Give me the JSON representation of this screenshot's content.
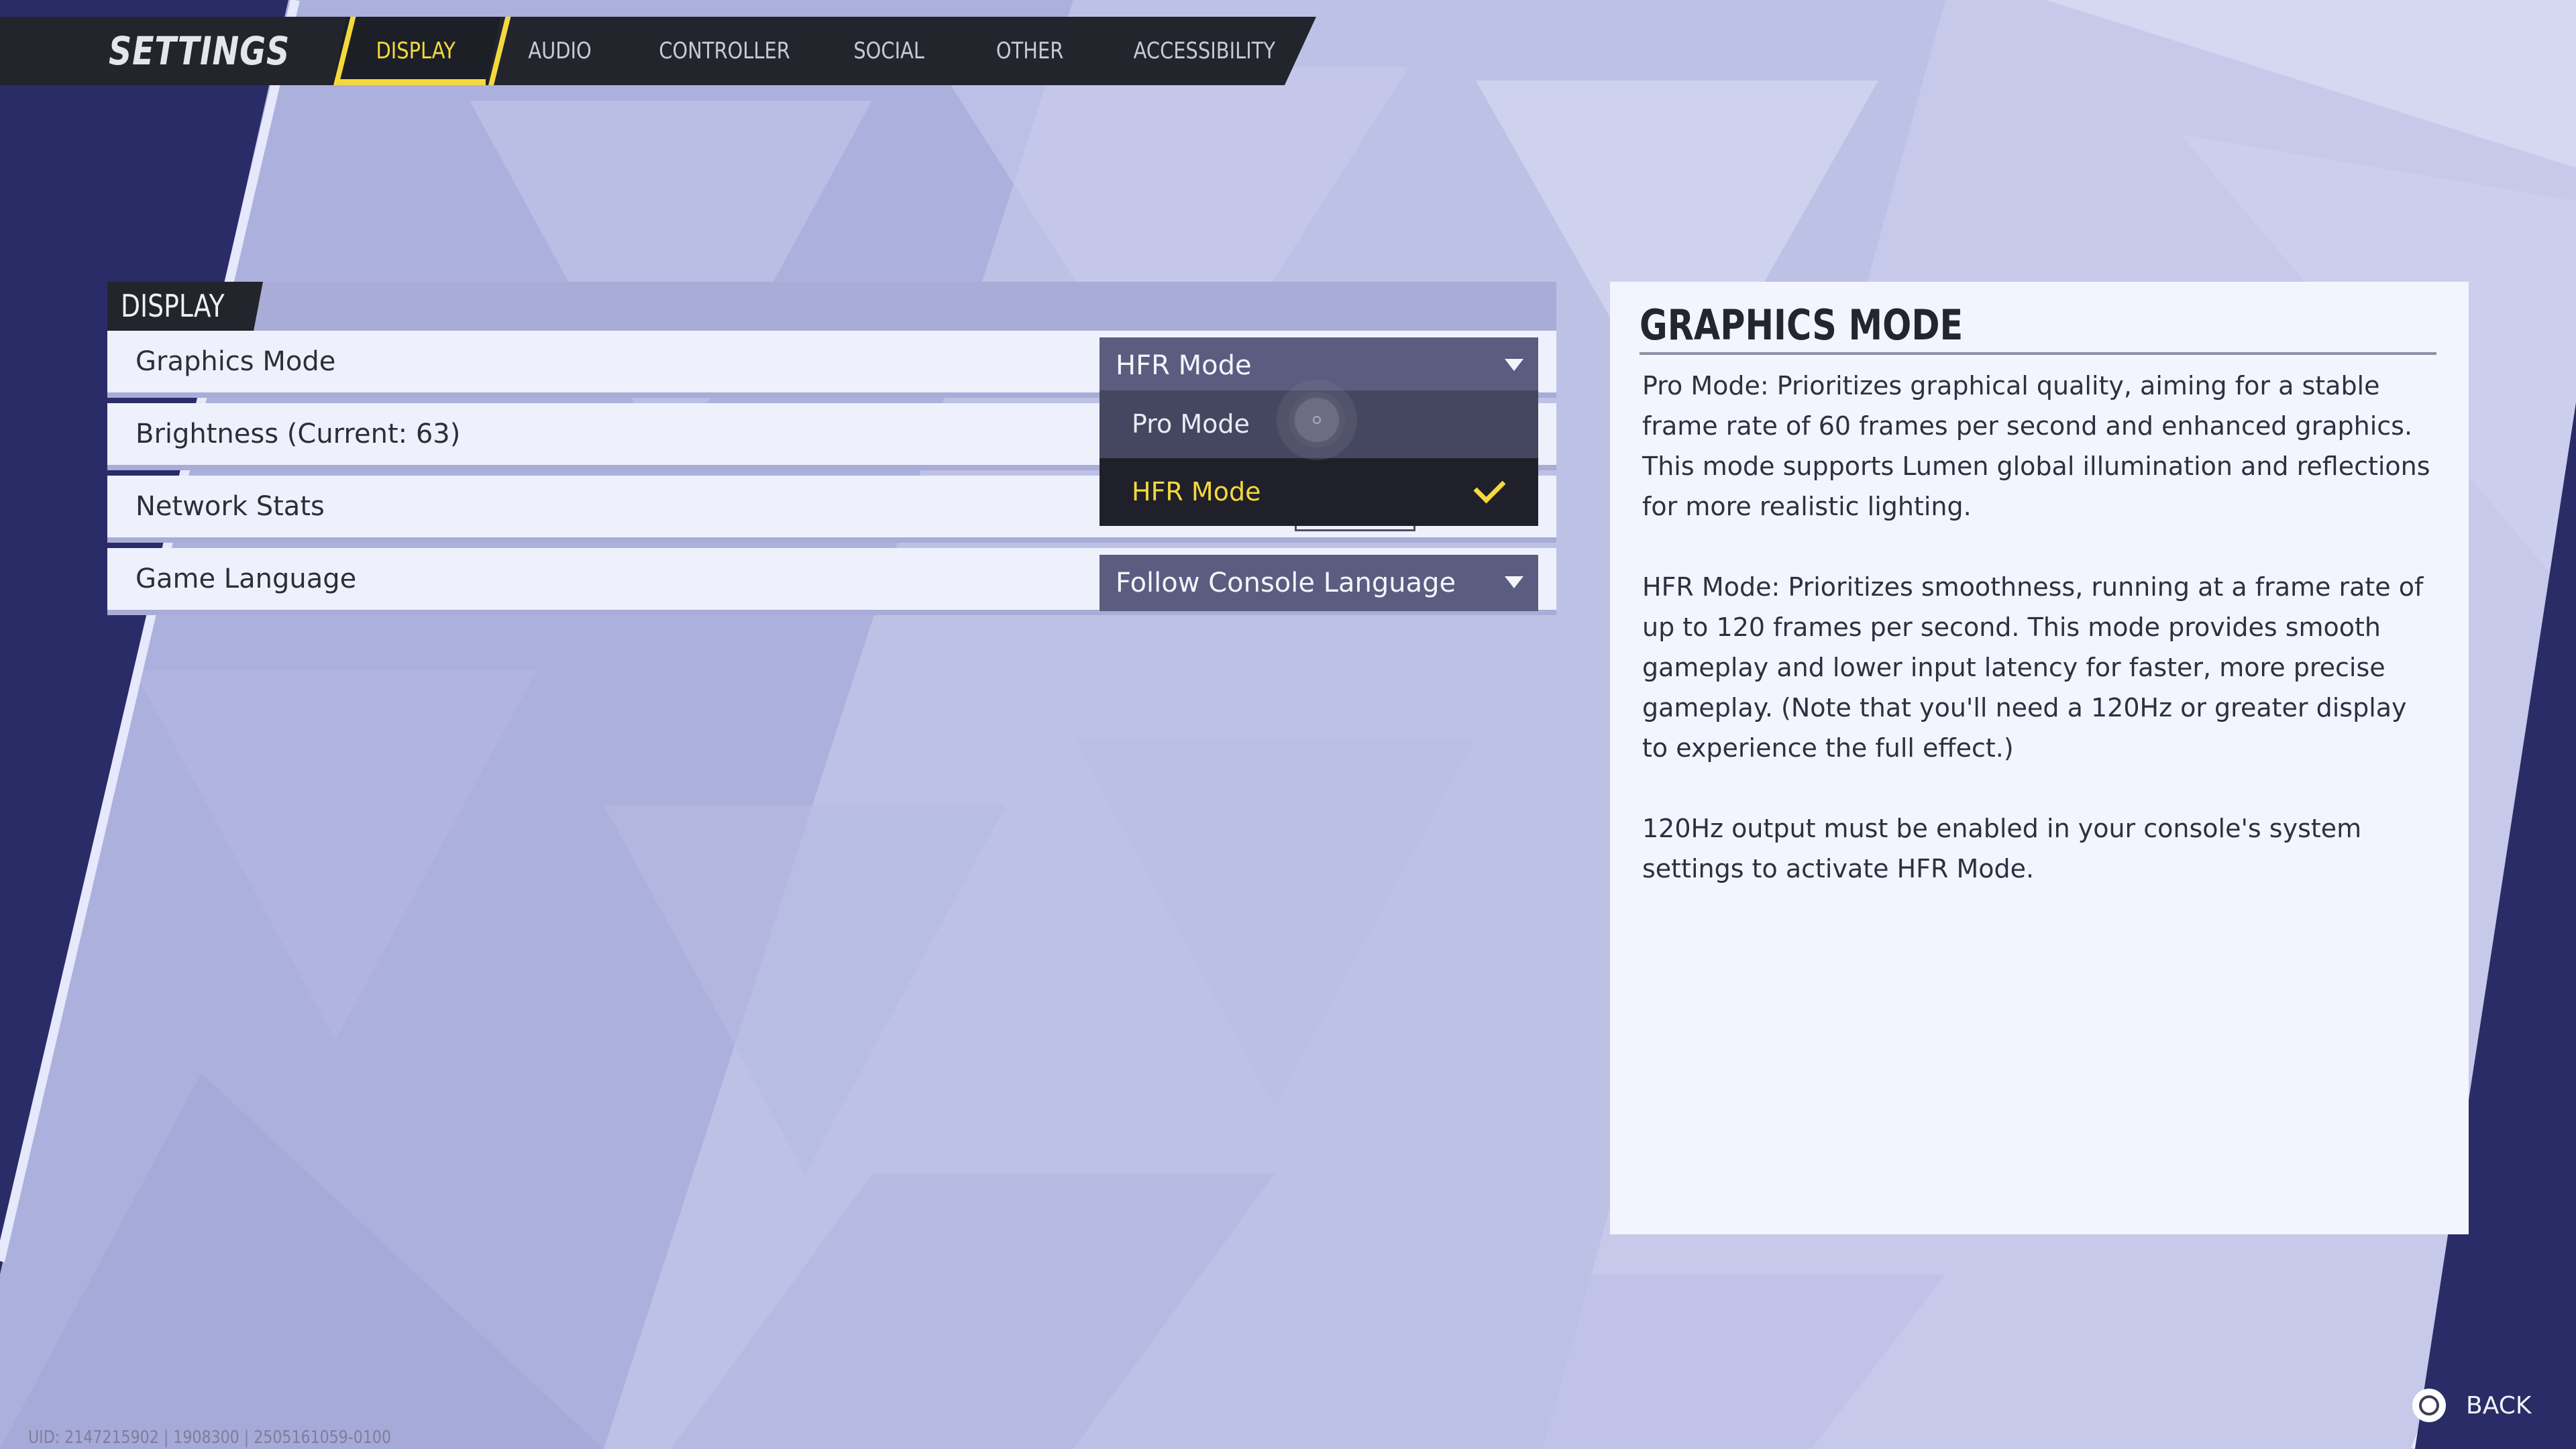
{
  "header": {
    "title": "SETTINGS",
    "tabs": [
      {
        "label": "DISPLAY",
        "active": true
      },
      {
        "label": "AUDIO"
      },
      {
        "label": "CONTROLLER"
      },
      {
        "label": "SOCIAL"
      },
      {
        "label": "OTHER"
      },
      {
        "label": "ACCESSIBILITY"
      }
    ]
  },
  "panel": {
    "section_title": "DISPLAY",
    "rows": [
      {
        "label": "Graphics Mode",
        "value": "HFR Mode"
      },
      {
        "label": "Brightness (Current: 63)"
      },
      {
        "label": "Network Stats"
      },
      {
        "label": "Game Language",
        "value": "Follow Console Language"
      }
    ],
    "graphics_dropdown_options": [
      {
        "label": "Pro Mode",
        "state": "hovered"
      },
      {
        "label": "HFR Mode",
        "state": "selected"
      }
    ]
  },
  "info": {
    "title": "GRAPHICS MODE",
    "paragraphs": [
      "Pro Mode: Prioritizes graphical quality, aiming for a stable frame rate of 60 frames per second and enhanced graphics. This mode supports Lumen global illumination and reflections for more realistic lighting.",
      "HFR Mode: Prioritizes smoothness, running at a frame rate of up to 120 frames per second. This mode provides smooth gameplay and lower input latency for faster, more precise gameplay. (Note that you'll need a 120Hz or greater display to experience the full effect.)",
      "120Hz output must be enabled in your console's system settings to activate HFR Mode."
    ]
  },
  "footer": {
    "back_label": "BACK",
    "back_icon": "circle-button-icon",
    "uid_text": "UID: 2147215902 | 1908300 | 2505161059-0100"
  },
  "colors": {
    "accent": "#f4d93c",
    "bar": "#23252d",
    "dropdown": "#5a5d80",
    "panel_row": "#eef1fb",
    "panel_header": "#a9acd6",
    "background": "#b9bde3",
    "background_dark": "#2a2c68"
  }
}
